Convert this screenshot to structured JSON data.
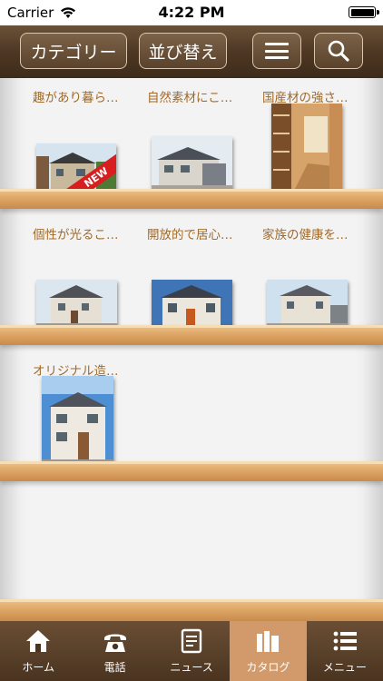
{
  "status_bar": {
    "carrier": "Carrier",
    "time": "4:22 PM"
  },
  "toolbar": {
    "category_label": "カテゴリー",
    "sort_label": "並び替え",
    "menu_icon": "hamburger-icon",
    "search_icon": "search-icon"
  },
  "catalog": {
    "items": [
      {
        "title": "趣があり暮ら…",
        "badge": "NEW"
      },
      {
        "title": "自然素材にこ…"
      },
      {
        "title": "国産材の強さ…"
      },
      {
        "title": "個性が光るこ…"
      },
      {
        "title": "開放的で居心…"
      },
      {
        "title": "家族の健康を…"
      },
      {
        "title": "オリジナル造…"
      }
    ]
  },
  "tabbar": {
    "tabs": [
      {
        "label": "ホーム",
        "icon": "home-icon"
      },
      {
        "label": "電話",
        "icon": "phone-icon"
      },
      {
        "label": "ニュース",
        "icon": "news-icon"
      },
      {
        "label": "カタログ",
        "icon": "catalog-icon",
        "active": true
      },
      {
        "label": "メニュー",
        "icon": "menu-list-icon"
      }
    ]
  }
}
